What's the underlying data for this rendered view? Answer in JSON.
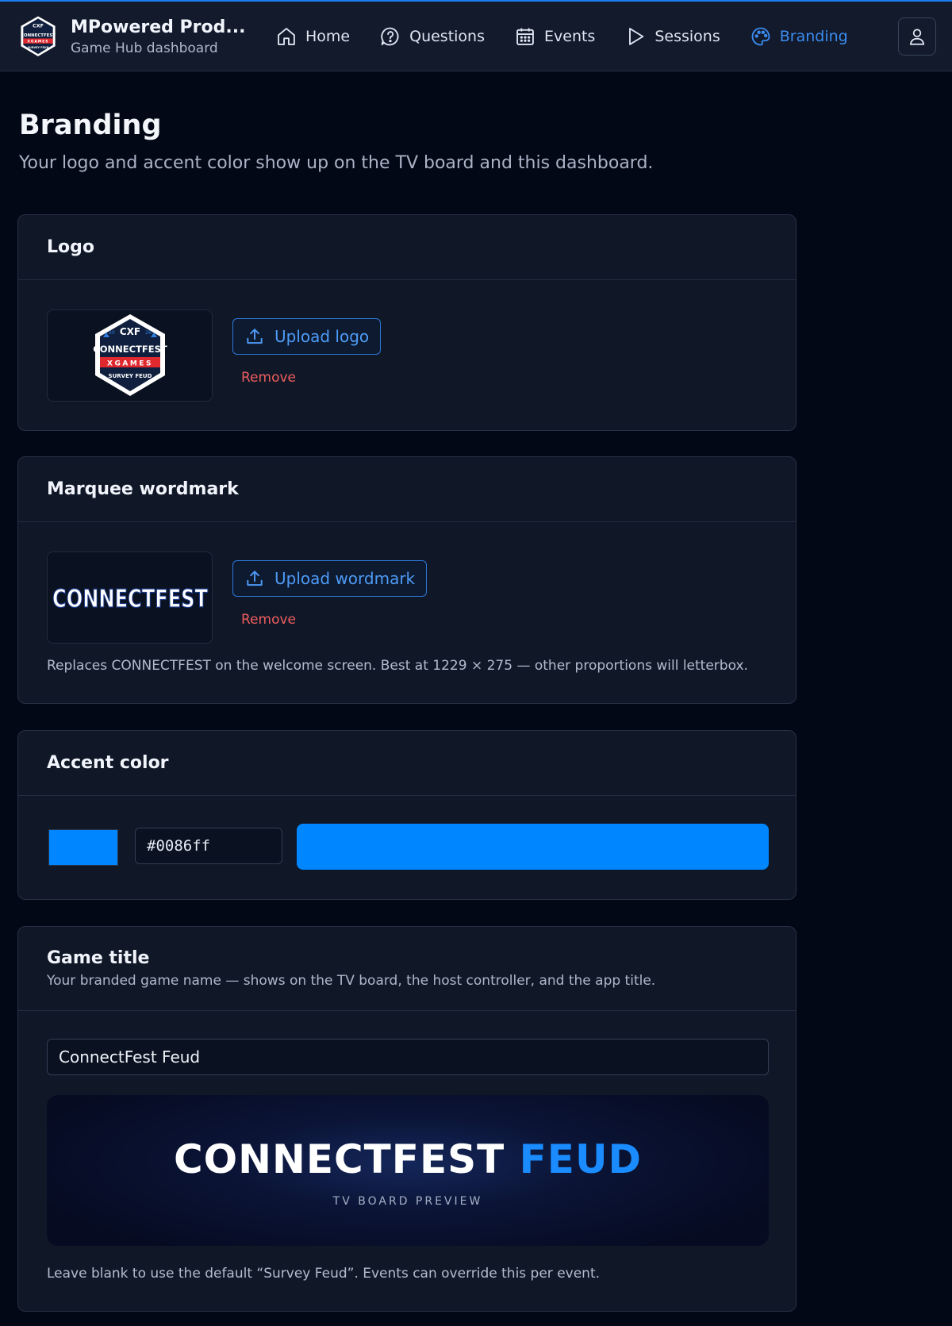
{
  "header": {
    "app_name": "MPowered Prod...",
    "app_subtitle": "Game Hub dashboard",
    "nav": [
      {
        "label": "Home",
        "icon": "home-icon",
        "active": false
      },
      {
        "label": "Questions",
        "icon": "question-icon",
        "active": false
      },
      {
        "label": "Events",
        "icon": "calendar-icon",
        "active": false
      },
      {
        "label": "Sessions",
        "icon": "play-icon",
        "active": false
      },
      {
        "label": "Branding",
        "icon": "palette-icon",
        "active": true
      }
    ],
    "user_icon": "user-icon",
    "brand_logo_text": {
      "top": "CXF",
      "year_left": "20",
      "year_right": "26",
      "main": "CONNECTFEST",
      "band": "XGAMES",
      "bottom": "SURVEY FEUD"
    }
  },
  "page": {
    "title": "Branding",
    "subtitle": "Your logo and accent color show up on the TV board and this dashboard."
  },
  "logo_card": {
    "title": "Logo",
    "upload_label": "Upload logo",
    "remove_label": "Remove",
    "logo_text": {
      "top": "CXF",
      "year_left": "20",
      "year_right": "26",
      "main": "CONNECTFEST",
      "band": "XGAMES",
      "bottom": "SURVEY FEUD"
    }
  },
  "wordmark_card": {
    "title": "Marquee wordmark",
    "upload_label": "Upload wordmark",
    "remove_label": "Remove",
    "wordmark_text": "CONNECTFEST",
    "hint": "Replaces CONNECTFEST on the welcome screen. Best at 1229 × 275 — other proportions will letterbox."
  },
  "accent_card": {
    "title": "Accent color",
    "hex_value": "#0086ff",
    "color": "#0086ff"
  },
  "game_title_card": {
    "title": "Game title",
    "subtitle": "Your branded game name — shows on the TV board, the host controller, and the app title.",
    "input_value": "ConnectFest Feud",
    "preview_word1": "CONNECTFEST",
    "preview_word2": "FEUD",
    "preview_label": "TV BOARD PREVIEW",
    "hint": "Leave blank to use the default “Survey Feud”. Events can override this per event."
  },
  "colors": {
    "accent": "#0086ff",
    "active_nav": "#3b8cf0",
    "danger": "#ee5d5d",
    "background": "#030816",
    "card": "#101828"
  }
}
